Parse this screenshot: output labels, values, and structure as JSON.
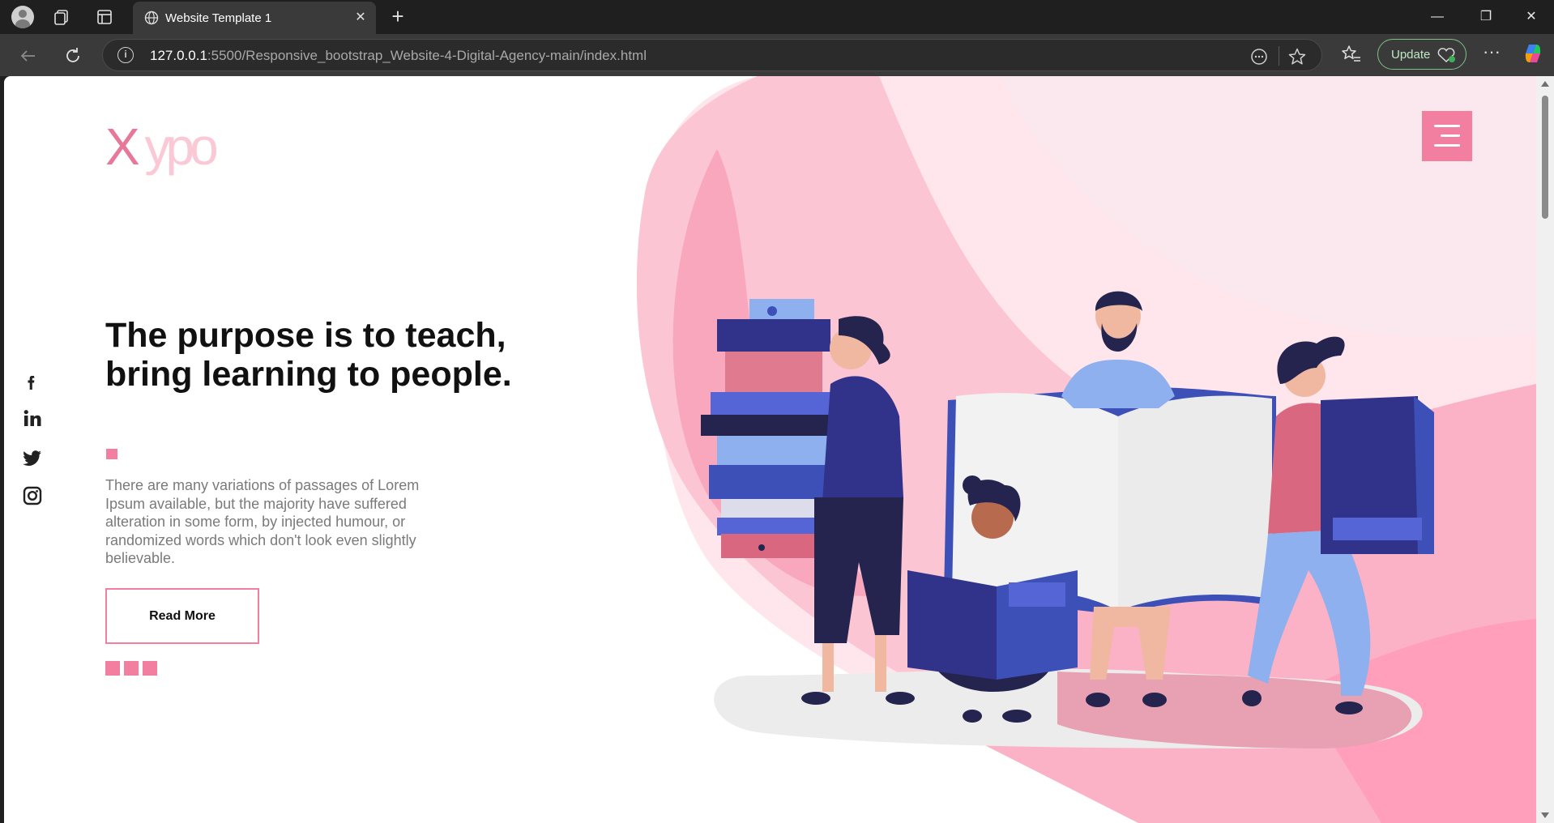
{
  "browser": {
    "tab_title": "Website Template 1",
    "url_host": "127.0.0.1",
    "url_path": ":5500/Responsive_bootstrap_Website-4-Digital-Agency-main/index.html",
    "update_label": "Update",
    "icons": [
      "profile-avatar",
      "workspaces-icon",
      "tab-actions-icon",
      "globe-icon",
      "close-icon",
      "plus-icon",
      "back-icon",
      "reload-icon",
      "info-icon",
      "read-aloud-icon",
      "star-icon",
      "favorites-icon",
      "health-heart-icon",
      "more-icon",
      "copilot-icon"
    ]
  },
  "page": {
    "logo_first": "X",
    "logo_rest": "ypo",
    "headline": "The purpose is to teach, bring learning to people.",
    "body": "There are many variations of passages of Lorem Ipsum available, but the majority have suffered alteration in some form, by injected humour, or randomized words which don't look even slightly believable.",
    "cta": "Read More",
    "social": [
      "facebook",
      "linkedin",
      "twitter",
      "instagram"
    ],
    "accent_color": "#f27ea0"
  }
}
